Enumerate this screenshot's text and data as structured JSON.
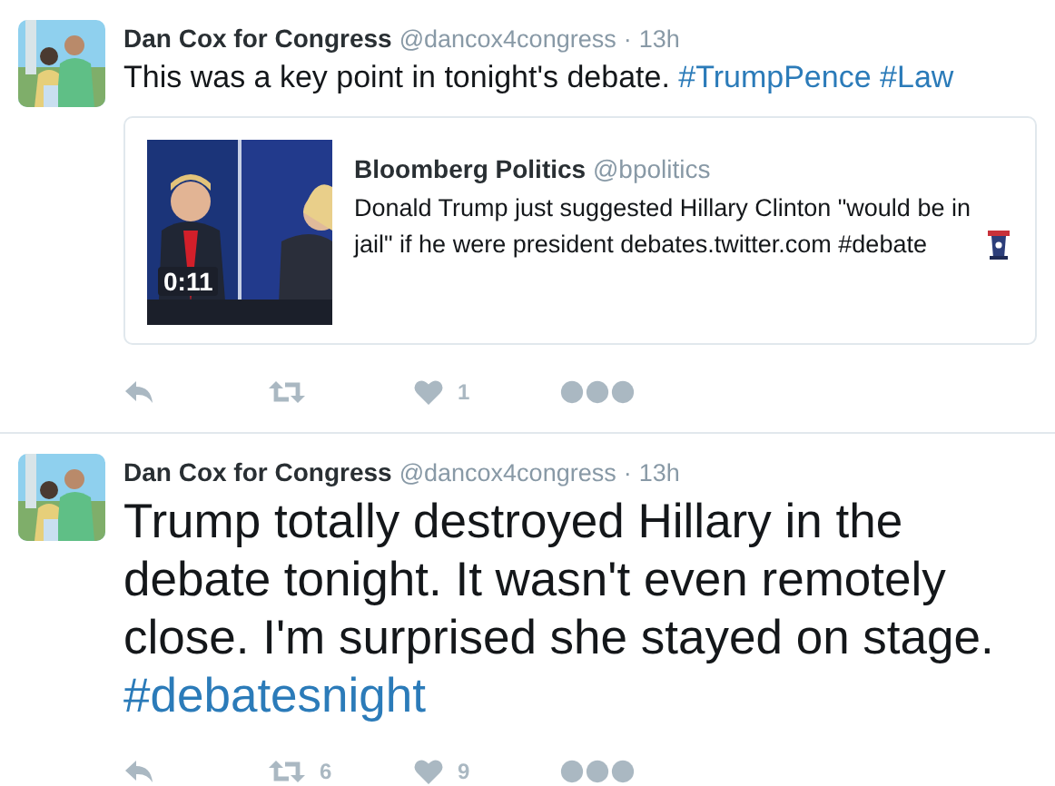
{
  "tweets": [
    {
      "kind": "quote",
      "author": {
        "name": "Dan Cox for Congress",
        "handle": "@dancox4congress",
        "separator": "·",
        "time": "13h"
      },
      "text": [
        {
          "kind": "text",
          "text": "This was a key point in tonight's debate."
        },
        {
          "kind": "hashtag",
          "text": "#TrumpPence"
        },
        {
          "kind": "hashtag",
          "text": "#Law"
        }
      ],
      "quote": {
        "name": "Bloomberg Politics",
        "handle": "@bpolitics",
        "text": "Donald Trump just suggested Hillary Clinton \"would be in jail\" if he were president debates.twitter.com #debate",
        "media": {
          "kind": "picture",
          "duration": "0:11"
        }
      },
      "actions": [
        {
          "kind": "reply"
        },
        {
          "kind": "retweet"
        },
        {
          "kind": "like",
          "count": "1"
        },
        {
          "kind": "more"
        }
      ]
    },
    {
      "kind": "text",
      "author": {
        "name": "Dan Cox for Congress",
        "handle": "@dancox4congress",
        "separator": "·",
        "time": "13h"
      },
      "text": [
        {
          "kind": "text",
          "text": "Trump totally destroyed Hillary in the debate tonight. It wasn't even remotely close. I'm surprised she stayed on stage."
        },
        {
          "kind": "hashtag",
          "text": "#debatesnight"
        }
      ],
      "actions": [
        {
          "kind": "reply"
        },
        {
          "kind": "retweet",
          "count": "6"
        },
        {
          "kind": "like",
          "count": "9"
        },
        {
          "kind": "more"
        }
      ]
    }
  ]
}
